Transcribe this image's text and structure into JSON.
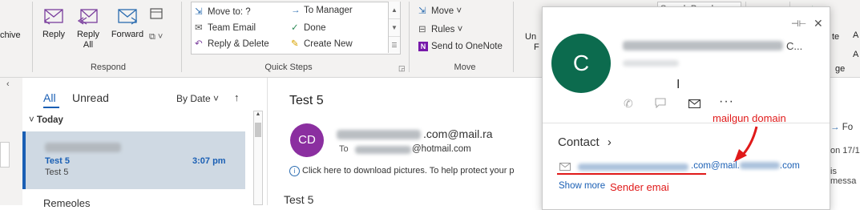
{
  "ribbon": {
    "respond": {
      "left_label": "chive",
      "reply": "Reply",
      "reply_all_1": "Reply",
      "reply_all_2": "All",
      "forward": "Forward",
      "group_label": "Respond"
    },
    "quick_steps": {
      "move_to": "Move to: ?",
      "team_email": "Team Email",
      "reply_delete": "Reply & Delete",
      "to_manager": "To Manager",
      "done": "Done",
      "create_new": "Create New",
      "group_label": "Quick Steps"
    },
    "move": {
      "move": "Move",
      "rules": "Rules",
      "onenote": "Send to OneNote",
      "group_label": "Move"
    },
    "partial": {
      "un": "Un",
      "f": "F",
      "te": "te",
      "ge": "ge",
      "a1": "A",
      "a2": "A"
    },
    "search_people": "Search People"
  },
  "message_list": {
    "tab_all": "All",
    "tab_unread": "Unread",
    "sort": "By Date",
    "group_today": "Today",
    "selected": {
      "subject": "Test 5",
      "time": "3:07 pm",
      "preview": "Test 5"
    },
    "next_partial": "Remeoles"
  },
  "reading_pane": {
    "subject": "Test 5",
    "avatar_initials": "CD",
    "from_suffix": ".com@mail.ra",
    "to_label": "To",
    "to_suffix": "@hotmail.com",
    "info_bar": "Click here to download pictures. To help protect your p",
    "body": "Test 5",
    "right_partial_1": "Fo",
    "right_partial_2": "on 17/1",
    "right_partial_3": "is messa"
  },
  "contact_card": {
    "avatar_initial": "C",
    "name_partial": "C...",
    "contact_label": "Contact",
    "email_domain": ".com@mail.",
    "email_tld": ".com",
    "show_more": "Show more"
  },
  "annotations": {
    "mailgun": "mailgun domain",
    "sender": "Sender emai",
    "color": "#e01a1a"
  },
  "colors": {
    "accent": "#1a5fb4",
    "reading_avatar": "#8b2fa0",
    "card_avatar": "#0c6b4e",
    "selected_row": "#cfd9e3"
  },
  "icons": {
    "reply": "reply-icon",
    "reply_all": "reply-all-icon",
    "forward": "forward-icon",
    "phone": "phone-icon",
    "chat": "chat-icon",
    "mail": "mail-icon",
    "more": "more-icon",
    "pin": "pin-icon",
    "close": "close-icon"
  }
}
